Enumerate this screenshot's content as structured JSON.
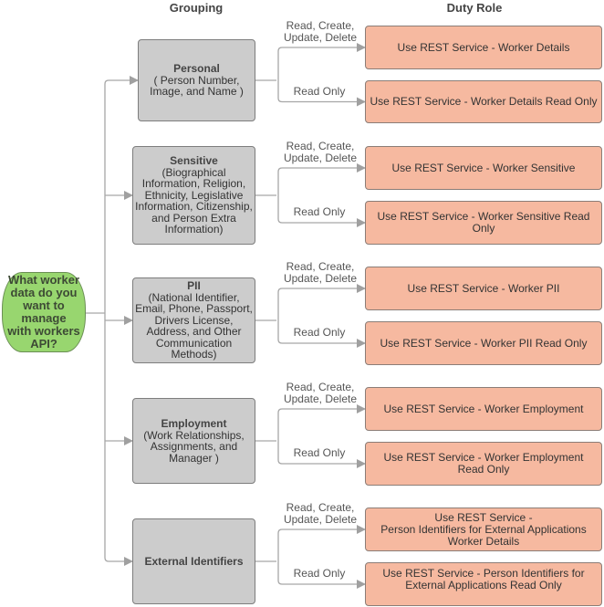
{
  "headers": {
    "grouping": "Grouping",
    "duty_role": "Duty Role"
  },
  "start": {
    "text": "What worker data do you want to manage with workers API?",
    "lines": [
      "What worker",
      "data do you",
      "want to manage",
      "with workers",
      "API?"
    ]
  },
  "colors": {
    "start_fill": "#98d66f",
    "group_fill": "#cccccc",
    "duty_fill": "#f6b9a0",
    "connector": "#a0a0a0"
  },
  "edge_labels": {
    "full": [
      "Read, Create,",
      "Update, Delete"
    ],
    "read_only": "Read Only"
  },
  "groups": [
    {
      "title": "Personal",
      "lines": [
        "( Person Number,",
        "Image, and Name )"
      ],
      "duties": [
        "Use REST Service - Worker Details",
        "Use REST Service - Worker Details Read Only"
      ]
    },
    {
      "title": "Sensitive",
      "lines": [
        "(Biographical",
        "Information, Religion,",
        "Ethnicity, Legislative",
        "Information, Citizenship,",
        "and Person Extra",
        "Information)"
      ],
      "duties": [
        "Use REST Service - Worker Sensitive",
        "Use REST Service - Worker Sensitive Read Only"
      ]
    },
    {
      "title": "PII",
      "lines": [
        "(National Identifier,",
        "Email, Phone, Passport,",
        "Drivers License,",
        "Address, and Other",
        "Communication",
        "Methods)"
      ],
      "duties": [
        "Use REST Service - Worker PII",
        "Use REST Service - Worker PII Read Only"
      ]
    },
    {
      "title": "Employment",
      "lines": [
        "(Work Relationships,",
        "Assignments, and",
        "Manager )"
      ],
      "duties": [
        "Use REST Service - Worker Employment",
        "Use REST Service - Worker Employment Read Only"
      ]
    },
    {
      "title": "External Identifiers",
      "lines": [],
      "duties": [
        "Use REST Service - Person Identifiers for External Applications Worker Details",
        "Use REST Service - Person Identifiers for External Applications Read Only"
      ]
    }
  ]
}
